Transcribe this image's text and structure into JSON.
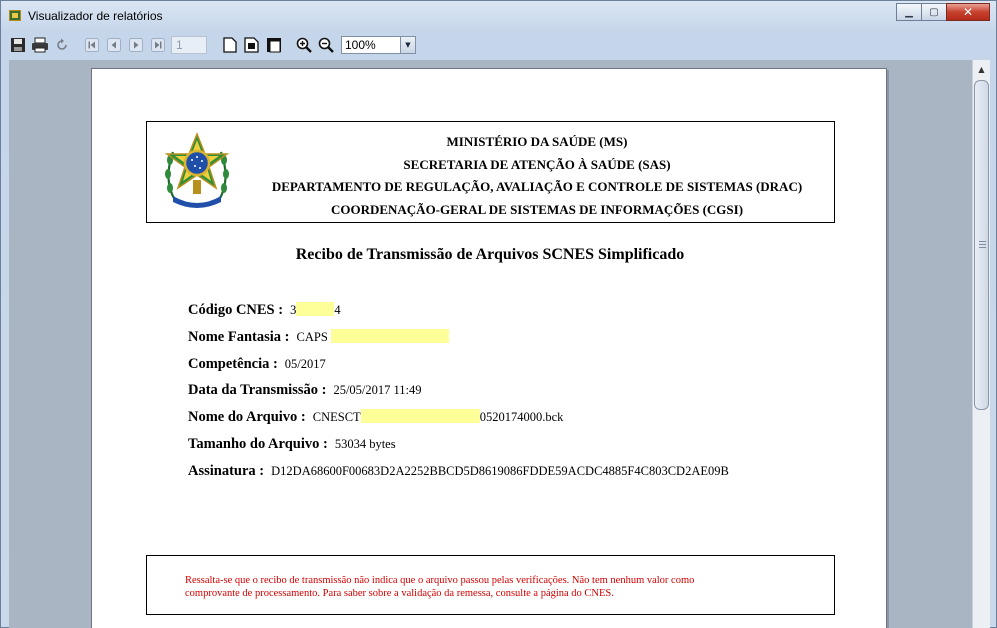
{
  "window": {
    "title": "Visualizador de relatórios",
    "buttons": [
      "minimize",
      "maximize",
      "close"
    ]
  },
  "toolbar": {
    "page_number": "1",
    "zoom_value": "100%",
    "icons": [
      "save-icon",
      "print-icon",
      "refresh-icon",
      "first-page-icon",
      "previous-page-icon",
      "next-page-icon",
      "last-page-icon",
      "single-page-icon",
      "page-width-icon",
      "multi-page-icon",
      "zoom-in-icon",
      "zoom-out-icon"
    ]
  },
  "report": {
    "header": {
      "line1": "MINISTÉRIO DA SAÚDE (MS)",
      "line2": "SECRETARIA DE ATENÇÃO À SAÚDE (SAS)",
      "line3": "DEPARTAMENTO DE REGULAÇÃO, AVALIAÇÃO E CONTROLE DE SISTEMAS (DRAC)",
      "line4": "COORDENAÇÃO-GERAL DE SISTEMAS DE INFORMAÇÕES (CGSI)"
    },
    "title": "Recibo de Transmissão de Arquivos SCNES Simplificado",
    "fields": {
      "codigo_cnes": {
        "label": "Código CNES :",
        "value_prefix": "3",
        "value_suffix": "4"
      },
      "nome_fantasia": {
        "label": "Nome Fantasia :",
        "value_prefix": "CAPS"
      },
      "competencia": {
        "label": "Competência :",
        "value": "05/2017"
      },
      "data_transmissao": {
        "label": "Data da Transmissão :",
        "value": "25/05/2017 11:49"
      },
      "nome_arquivo": {
        "label": "Nome do Arquivo :",
        "value_prefix": "CNESCT",
        "value_suffix": "0520174000.bck"
      },
      "tamanho_arquivo": {
        "label": "Tamanho do Arquivo :",
        "value": "53034 bytes"
      },
      "assinatura": {
        "label": "Assinatura :",
        "value": "D12DA68600F00683D2A2252BBCD5D8619086FDDE59ACDC4885F4C803CD2AE09B"
      }
    },
    "notice": {
      "line1": "Ressalta-se que o recibo de transmissão não indica que o arquivo passou pelas verificações. Não tem nenhum valor como",
      "line2": "comprovante de processamento. Para saber sobre a validação da remessa, consulte a página do CNES."
    }
  },
  "colors": {
    "highlight": "#ffff99",
    "notice_text": "#d40000"
  }
}
